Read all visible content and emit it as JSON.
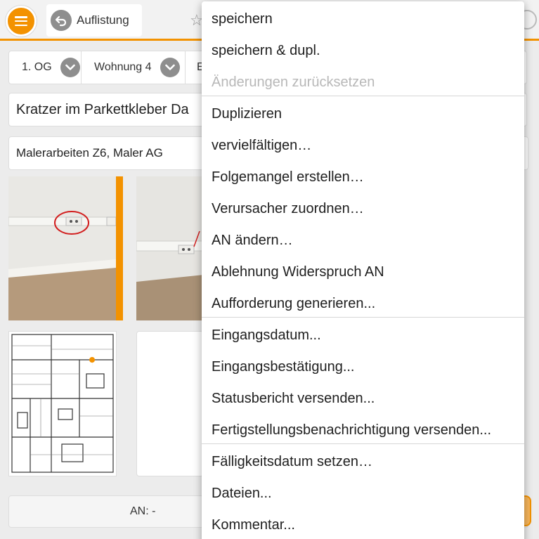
{
  "header": {
    "back_label": "Auflistung"
  },
  "location": {
    "floor": "1. OG",
    "unit": "Wohnung 4",
    "third_partial": "E"
  },
  "defect": {
    "title": "Kratzer im Parkettkleber Da",
    "contractor": "Malerarbeiten Z6, Maler AG"
  },
  "footer": {
    "an_label": "AN: -"
  },
  "context_menu": {
    "groups": [
      {
        "items": [
          {
            "label": "speichern",
            "enabled": true
          },
          {
            "label": "speichern & dupl.",
            "enabled": true
          },
          {
            "label": "Änderungen zurücksetzen",
            "enabled": false
          }
        ]
      },
      {
        "items": [
          {
            "label": "Duplizieren",
            "enabled": true
          },
          {
            "label": "vervielfältigen…",
            "enabled": true
          },
          {
            "label": "Folgemangel erstellen…",
            "enabled": true
          },
          {
            "label": "Verursacher zuordnen…",
            "enabled": true
          },
          {
            "label": "AN ändern…",
            "enabled": true
          },
          {
            "label": "Ablehnung Widerspruch AN",
            "enabled": true
          },
          {
            "label": "Aufforderung generieren...",
            "enabled": true
          }
        ]
      },
      {
        "items": [
          {
            "label": "Eingangsdatum...",
            "enabled": true
          },
          {
            "label": "Eingangsbestätigung...",
            "enabled": true
          },
          {
            "label": "Statusbericht versenden...",
            "enabled": true
          },
          {
            "label": "Fertigstellungsbenachrichtigung versenden...",
            "enabled": true
          }
        ]
      },
      {
        "items": [
          {
            "label": "Fälligkeitsdatum setzen…",
            "enabled": true
          },
          {
            "label": "Dateien...",
            "enabled": true
          },
          {
            "label": "Kommentar...",
            "enabled": true
          }
        ]
      }
    ]
  },
  "colors": {
    "accent": "#f39200",
    "disabled_text": "#b8b8b8"
  },
  "icons": [
    "menu-icon",
    "back-arrow-icon",
    "star-icon",
    "chevron-down-icon"
  ]
}
